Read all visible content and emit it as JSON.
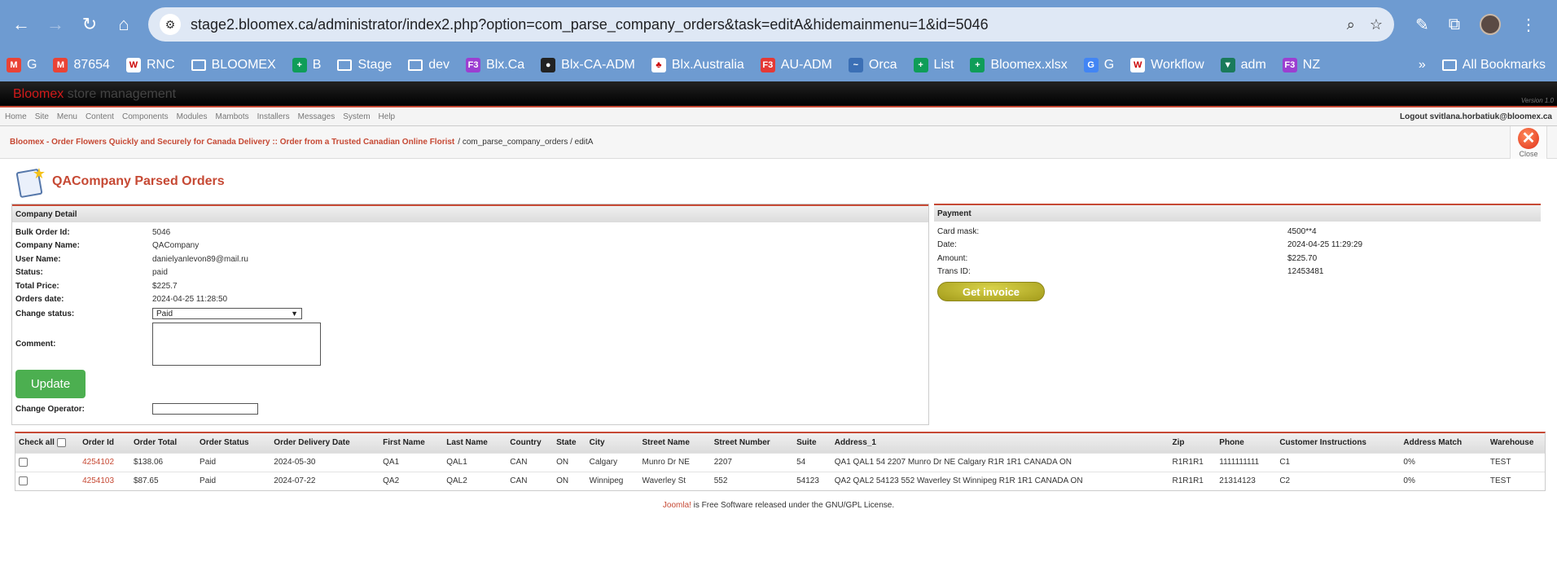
{
  "browser": {
    "url": "stage2.bloomex.ca/administrator/index2.php?option=com_parse_company_orders&task=editA&hidemainmenu=1&id=5046",
    "bookmarks": [
      {
        "label": "G",
        "icon": "gmail-icon",
        "color": "#ea4335",
        "glyph": "M"
      },
      {
        "label": "87654",
        "icon": "gmail-icon",
        "color": "#ea4335",
        "glyph": "M"
      },
      {
        "label": "RNC",
        "icon": "wikipedia-icon",
        "color": "#ffffff",
        "glyph": "W"
      },
      {
        "label": "BLOOMEX",
        "icon": "folder-icon",
        "color": "",
        "glyph": ""
      },
      {
        "label": "B",
        "icon": "sheets-icon",
        "color": "#0f9d58",
        "glyph": "+"
      },
      {
        "label": "Stage",
        "icon": "folder-icon",
        "color": "",
        "glyph": ""
      },
      {
        "label": "dev",
        "icon": "folder-icon",
        "color": "",
        "glyph": ""
      },
      {
        "label": "Blx.Ca",
        "icon": "f3-icon",
        "color": "#9c3fd1",
        "glyph": "F3"
      },
      {
        "label": "Blx-CA-ADM",
        "icon": "globe-icon",
        "color": "#222222",
        "glyph": "●"
      },
      {
        "label": "Blx.Australia",
        "icon": "bloomex-icon",
        "color": "#ffffff",
        "glyph": "♣"
      },
      {
        "label": "AU-ADM",
        "icon": "f3-icon",
        "color": "#e53935",
        "glyph": "F3"
      },
      {
        "label": "Orca",
        "icon": "orca-icon",
        "color": "#3b6fb5",
        "glyph": "~"
      },
      {
        "label": "List",
        "icon": "sheets-icon",
        "color": "#0f9d58",
        "glyph": "+"
      },
      {
        "label": "Bloomex.xlsx",
        "icon": "sheets-icon",
        "color": "#0f9d58",
        "glyph": "+"
      },
      {
        "label": "G",
        "icon": "translate-icon",
        "color": "#4285f4",
        "glyph": "G"
      },
      {
        "label": "Workflow",
        "icon": "wikipedia-icon",
        "color": "#ffffff",
        "glyph": "W"
      },
      {
        "label": "adm",
        "icon": "adm-icon",
        "color": "#1a7a5a",
        "glyph": "▼"
      },
      {
        "label": "NZ",
        "icon": "f3-icon",
        "color": "#9c3fd1",
        "glyph": "F3"
      }
    ],
    "more": "»",
    "all_bookmarks": "All Bookmarks"
  },
  "header": {
    "brand_red": "Bloomex",
    "brand_grey": "store management",
    "version": "Version 1.0"
  },
  "menu": {
    "items": [
      "Home",
      "Site",
      "Menu",
      "Content",
      "Components",
      "Modules",
      "Mambots",
      "Installers",
      "Messages",
      "System",
      "Help"
    ],
    "logout": "Logout svitlana.horbatiuk@bloomex.ca"
  },
  "pathway": {
    "site": "Bloomex - Order Flowers Quickly and Securely for Canada Delivery :: Order from a Trusted Canadian Online Florist",
    "rest": "/ com_parse_company_orders / editA",
    "close": "Close"
  },
  "page": {
    "title": "QACompany Parsed Orders"
  },
  "company": {
    "heading": "Company Detail",
    "rows": [
      {
        "k": "Bulk Order Id:",
        "v": "5046"
      },
      {
        "k": "Company Name:",
        "v": "QACompany"
      },
      {
        "k": "User Name:",
        "v": "danielyanlevon89@mail.ru"
      },
      {
        "k": "Status:",
        "v": "paid"
      },
      {
        "k": "Total Price:",
        "v": "$225.7"
      },
      {
        "k": "Orders date:",
        "v": "2024-04-25 11:28:50"
      }
    ],
    "change_status_label": "Change status:",
    "status_value": "Paid",
    "comment_label": "Comment:",
    "update_button": "Update",
    "change_operator_label": "Change Operator:"
  },
  "payment": {
    "heading": "Payment",
    "rows": [
      {
        "k": "Card mask:",
        "v": "4500**4"
      },
      {
        "k": "Date:",
        "v": "2024-04-25 11:29:29"
      },
      {
        "k": "Amount:",
        "v": "$225.70"
      },
      {
        "k": "Trans ID:",
        "v": "12453481"
      }
    ],
    "invoice_button": "Get invoice"
  },
  "orders": {
    "check_all": "Check all",
    "headers": [
      "Order Id",
      "Order Total",
      "Order Status",
      "Order Delivery Date",
      "First Name",
      "Last Name",
      "Country",
      "State",
      "City",
      "Street Name",
      "Street Number",
      "Suite",
      "Address_1",
      "Zip",
      "Phone",
      "Customer Instructions",
      "Address Match",
      "Warehouse"
    ],
    "rows": [
      [
        "4254102",
        "$138.06",
        "Paid",
        "2024-05-30",
        "QA1",
        "QAL1",
        "CAN",
        "ON",
        "Calgary",
        "Munro Dr NE",
        "2207",
        "54",
        "QA1 QAL1 54 2207 Munro Dr NE Calgary R1R 1R1 CANADA ON",
        "R1R1R1",
        "1111111111",
        "C1",
        "0%",
        "TEST"
      ],
      [
        "4254103",
        "$87.65",
        "Paid",
        "2024-07-22",
        "QA2",
        "QAL2",
        "CAN",
        "ON",
        "Winnipeg",
        "Waverley St",
        "552",
        "54123",
        "QA2 QAL2 54123 552 Waverley St Winnipeg R1R 1R1 CANADA ON",
        "R1R1R1",
        "21314123",
        "C2",
        "0%",
        "TEST"
      ]
    ]
  },
  "footer": {
    "link": "Joomla!",
    "text": " is Free Software released under the GNU/GPL License."
  }
}
